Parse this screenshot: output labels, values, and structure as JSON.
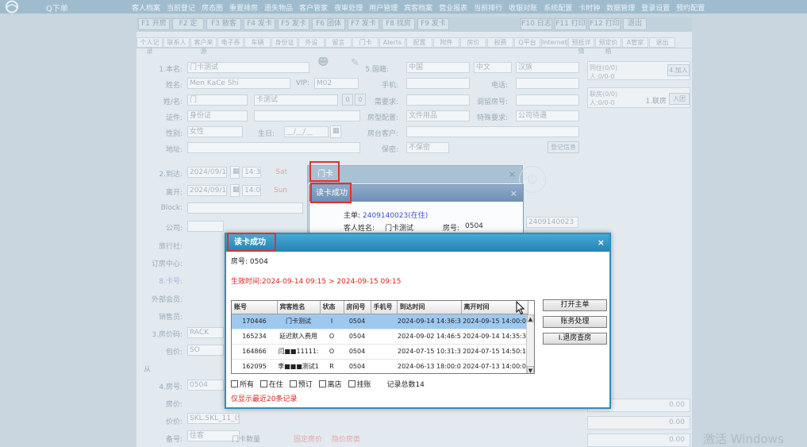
{
  "app": {
    "logo_text": "Q下单",
    "top_nav": [
      "客人档案",
      "当前登记",
      "房态图",
      "重置排房",
      "遗失物品",
      "客户管家",
      "夜审处理",
      "用户管理",
      "宾客档案",
      "营业报表",
      "当前排行",
      "收银对账",
      "系统配置",
      "卡时钟",
      "数据管理",
      "登录设置",
      "预约配置"
    ]
  },
  "form": {
    "toolbar": [
      "F1 开房",
      "F2 定",
      "F3 散客",
      "F4 发卡",
      "F5 发卡",
      "F6 团体",
      "F7 发卡",
      "F8 找房",
      "F9 发卡",
      "F10 日志",
      "F11 打印",
      "F12 打印",
      "退出"
    ],
    "tabs": [
      "个人记录",
      "联系人",
      "客户来源",
      "电子券",
      "车辆",
      "身份证",
      "外设",
      "留言",
      "门卡",
      "Alerts",
      "配置",
      "附件",
      "房价",
      "税费",
      "Q平台",
      "Internet",
      "预抵详情",
      "预定价格",
      "A管家",
      "退出"
    ],
    "labels": {
      "name": "1.本名:",
      "pinyin": "姓名:",
      "surname": "姓/名:",
      "idcard": "证件:",
      "gender": "性别:",
      "address": "地址:",
      "arrive": "2.到达:",
      "depart": "离开:",
      "block": "Block:",
      "company": "公司:",
      "agency": "旅行社:",
      "booking_center": "订房中心:",
      "card_no": "8.卡号:",
      "member": "外部会员:",
      "sales": "销售员:",
      "rate_code": "3.房价码:",
      "packages": "包价:",
      "from": "从",
      "room_no": "4.房号:",
      "room_rate": "房价:",
      "rate": "价价:",
      "remark": "备号:",
      "country": "5.国籍:",
      "mobile": "手机:",
      "phone": "电话:",
      "fixed_requirement": "需要求:",
      "room_prefs": "房型配置:",
      "notes_detail": "特殊要求:",
      "group": "房台客户:",
      "keep": "保密:"
    },
    "values": {
      "name": "门卡测试",
      "pinyin": "Men KaCe Shi",
      "vip": "VIP:",
      "vip_value": "M02",
      "surname": "门",
      "given": "卡测试",
      "idcard": "身份证",
      "gender": "女性",
      "birthday_label": "生日:",
      "birthday": "__/__/__",
      "arrive_date": "2024/09/14",
      "arrive_time": "14:36",
      "depart_date": "2024/09/15",
      "depart_time": "14:00",
      "sat": "Sat",
      "sun": "Sun",
      "rate_code": "RACK",
      "packages": "SO",
      "room_no": "0504",
      "rate_plan": "SKL.SKL_11_(SKL)",
      "remark": "住客",
      "country": "中国",
      "language": "中文",
      "nation": "汉族",
      "room_prefs": "文件用品",
      "notes_detail": "公司待遇",
      "keep": "不保密",
      "record_info": "登记信息",
      "master_no_right": "2409140023",
      "side_in": "同住(0/0)",
      "side_in2": "人:0/0-0",
      "side_add": "4.加入",
      "side_link": "联房(0/0)",
      "side_link2": "人:0/0-0",
      "side_link3": "1.联房",
      "side_join": "入团",
      "amount1": "0.00",
      "amount2": "0.00",
      "amount3": "0.00",
      "checkin_label": "门卡数量",
      "fixed_price": "固定房价",
      "hide_price": "隐价房类"
    }
  },
  "watermark": "激活 Windows",
  "back_dialog": {
    "title": "门卡",
    "close": "×"
  },
  "mid_dialog": {
    "title": "读卡成功",
    "close": "×",
    "master_label": "主单:",
    "master_value": "2409140023(在住)",
    "guest_label": "客人姓名:",
    "guest_value": "门卡测试",
    "room_label": "房号:",
    "room_value": "0504"
  },
  "main_dialog": {
    "title": "读卡成功",
    "close": "×",
    "room_line": "房号: 0504",
    "valid_line": "生效时间:2024-09-14 09:15 > 2024-09-15 09:15",
    "columns": [
      "账号",
      "宾客姓名",
      "状态",
      "房间号",
      "手机号",
      "到达时间",
      "离开时间"
    ],
    "rows": [
      {
        "acct": "170446",
        "name": "门卡测试",
        "status": "I",
        "room": "0504",
        "mobile": "",
        "arrive": "2024-09-14 14:36:3",
        "depart": "2024-09-15 14:00:0"
      },
      {
        "acct": "165234",
        "name": "延迟默入费用",
        "status": "O",
        "room": "0504",
        "mobile": "",
        "arrive": "2024-09-02 14:46:5",
        "depart": "2024-09-14 14:35:3"
      },
      {
        "acct": "164866",
        "name": "闫■■11111:",
        "status": "O",
        "room": "0504",
        "mobile": "",
        "arrive": "2024-07-15 10:31:3",
        "depart": "2024-07-15 14:50:1"
      },
      {
        "acct": "162095",
        "name": "李■■■测试1",
        "status": "R",
        "room": "0504",
        "mobile": "",
        "arrive": "2024-06-13 18:00:0",
        "depart": "2024-07-13 14:00:0"
      }
    ],
    "buttons": [
      "打开主单",
      "账务处理",
      "I.退房查房"
    ],
    "checkboxes": [
      "所有",
      "在住",
      "预订",
      "离店",
      "挂账"
    ],
    "record_count": "记录总数14",
    "note": "仅显示最近20条记录"
  }
}
